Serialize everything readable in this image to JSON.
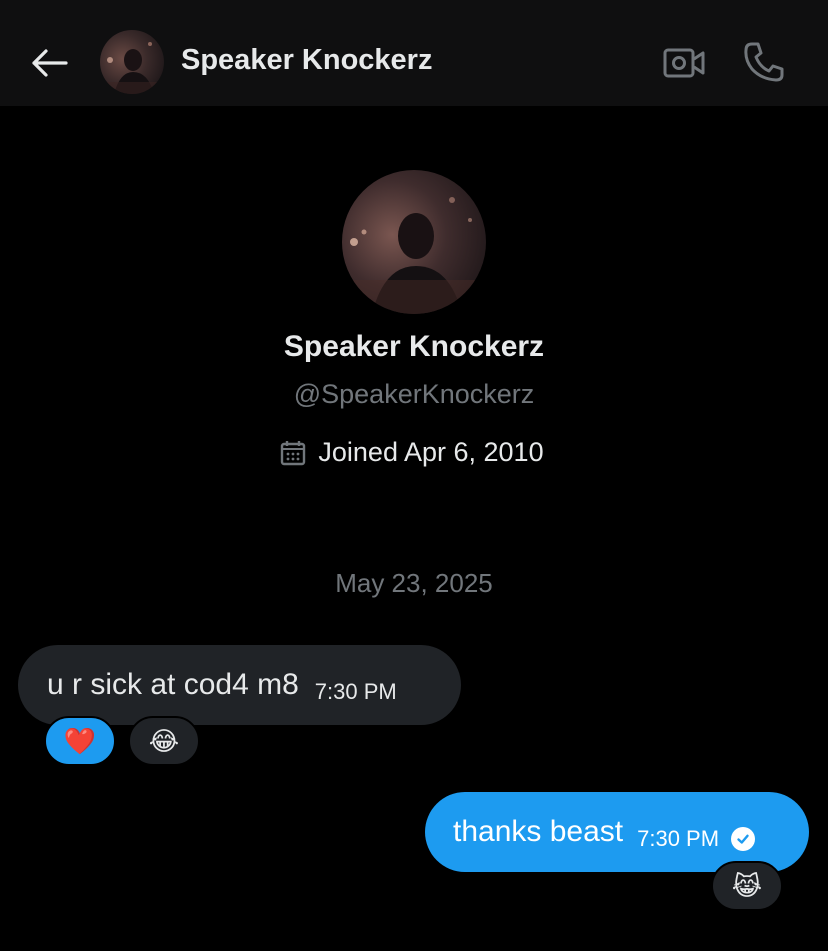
{
  "header": {
    "name": "Speaker Knockerz",
    "icons": [
      "back-arrow-icon",
      "video-call-icon",
      "phone-icon"
    ]
  },
  "profile": {
    "name": "Speaker Knockerz",
    "handle": "@SpeakerKnockerz",
    "joined": "Joined Apr 6, 2010"
  },
  "conversation": {
    "date": "May 23, 2025",
    "messages": [
      {
        "direction": "incoming",
        "text": "u r sick at cod4 m8",
        "time": "7:30 PM",
        "reactions": [
          "❤️",
          "😂"
        ]
      },
      {
        "direction": "outgoing",
        "text": "thanks beast",
        "time": "7:30 PM",
        "status": "read-check-icon",
        "reactions": [
          "😹"
        ]
      }
    ]
  },
  "colors": {
    "background": "#000000",
    "header": "#0f0f10",
    "accent": "#1d9bf0",
    "bubble_incoming": "#202327",
    "muted_text": "#71767b"
  }
}
